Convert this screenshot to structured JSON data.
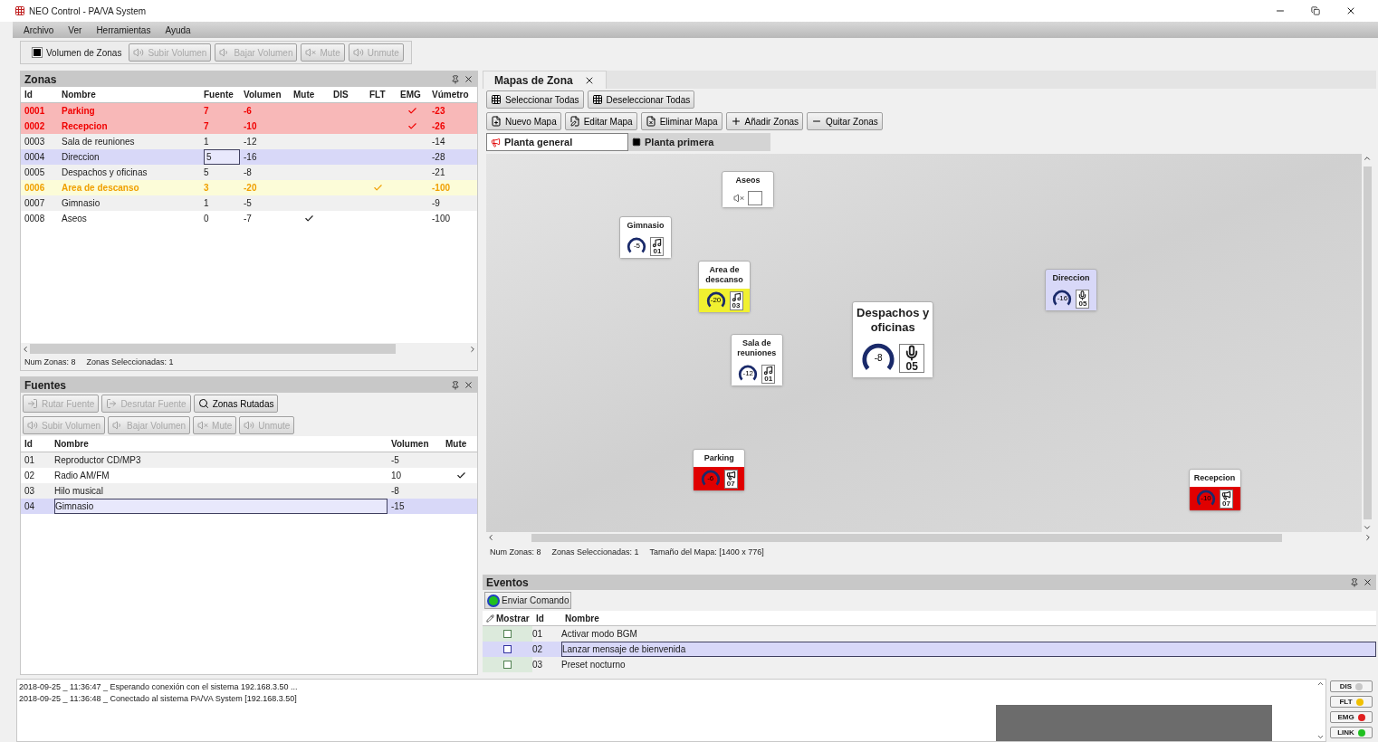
{
  "window": {
    "title": "NEO Control - PA/VA System"
  },
  "menu": [
    "Archivo",
    "Ver",
    "Herramientas",
    "Ayuda"
  ],
  "toolbar": {
    "toggle": {
      "label": "Volumen de Zonas",
      "checked": true
    },
    "buttons": [
      {
        "label": "Subir Volumen",
        "disabled": true
      },
      {
        "label": "Bajar Volumen",
        "disabled": true
      },
      {
        "label": "Mute",
        "disabled": true
      },
      {
        "label": "Unmute",
        "disabled": true
      }
    ]
  },
  "zones_panel": {
    "title": "Zonas",
    "columns": [
      "Id",
      "Nombre",
      "Fuente",
      "Volumen",
      "Mute",
      "DIS",
      "FLT",
      "EMG",
      "Vúmetro"
    ],
    "rows": [
      {
        "id": "0001",
        "name": "Parking",
        "source": "7",
        "volume": "-6",
        "mute": false,
        "dis": false,
        "flt": false,
        "emg": true,
        "vu": "-23",
        "selected": false
      },
      {
        "id": "0002",
        "name": "Recepcion",
        "source": "7",
        "volume": "-10",
        "mute": false,
        "dis": false,
        "flt": false,
        "emg": true,
        "vu": "-26",
        "selected": false
      },
      {
        "id": "0003",
        "name": "Sala de reuniones",
        "source": "1",
        "volume": "-12",
        "mute": false,
        "dis": false,
        "flt": false,
        "emg": false,
        "vu": "-14",
        "selected": false
      },
      {
        "id": "0004",
        "name": "Direccion",
        "source": "5",
        "volume": "-16",
        "mute": false,
        "dis": false,
        "flt": false,
        "emg": false,
        "vu": "-28",
        "selected": true
      },
      {
        "id": "0005",
        "name": "Despachos y oficinas",
        "source": "5",
        "volume": "-8",
        "mute": false,
        "dis": false,
        "flt": false,
        "emg": false,
        "vu": "-21",
        "selected": false
      },
      {
        "id": "0006",
        "name": "Area de descanso",
        "source": "3",
        "volume": "-20",
        "mute": false,
        "dis": false,
        "flt": true,
        "emg": false,
        "vu": "-100",
        "selected": false
      },
      {
        "id": "0007",
        "name": "Gimnasio",
        "source": "1",
        "volume": "-5",
        "mute": false,
        "dis": false,
        "flt": false,
        "emg": false,
        "vu": "-9",
        "selected": false
      },
      {
        "id": "0008",
        "name": "Aseos",
        "source": "0",
        "volume": "-7",
        "mute": true,
        "dis": false,
        "flt": false,
        "emg": false,
        "vu": "-100",
        "selected": false
      }
    ],
    "status": [
      "Num Zonas: 8",
      "Zonas Seleccionadas: 1"
    ]
  },
  "sources_panel": {
    "title": "Fuentes",
    "buttons_row_1": [
      {
        "label": "Rutar Fuente",
        "disabled": true
      },
      {
        "label": "Desrutar Fuente",
        "disabled": true
      },
      {
        "label": "Zonas Rutadas",
        "disabled": false
      }
    ],
    "buttons_row_2": [
      {
        "label": "Subir Volumen",
        "disabled": true
      },
      {
        "label": "Bajar Volumen",
        "disabled": true
      },
      {
        "label": "Mute",
        "disabled": true
      },
      {
        "label": "Unmute",
        "disabled": true
      }
    ],
    "columns": [
      "Id",
      "Nombre",
      "Volumen",
      "Mute"
    ],
    "rows": [
      {
        "id": "01",
        "name": "Reproductor CD/MP3",
        "volume": "-5",
        "mute": false,
        "selected": false
      },
      {
        "id": "02",
        "name": "Radio AM/FM",
        "volume": "10",
        "mute": true,
        "selected": false
      },
      {
        "id": "03",
        "name": "Hilo musical",
        "volume": "-8",
        "mute": false,
        "selected": false
      },
      {
        "id": "04",
        "name": "Gimnasio",
        "volume": "-15",
        "mute": false,
        "selected": true
      }
    ]
  },
  "map_panel": {
    "tab": "Mapas de Zona",
    "select_buttons": [
      "Seleccionar Todas",
      "Deseleccionar Todas"
    ],
    "map_buttons": [
      "Nuevo Mapa",
      "Editar Mapa",
      "Eliminar Mapa",
      "Añadir Zonas",
      "Quitar Zonas"
    ],
    "floors": [
      {
        "label": "Planta general",
        "selected": true
      },
      {
        "label": "Planta primera",
        "selected": false
      }
    ],
    "markers": [
      {
        "name": "Aseos",
        "muted": true,
        "selected": false,
        "emg": false,
        "flt": false,
        "large": false
      },
      {
        "name": "Gimnasio",
        "muted": false,
        "selected": false,
        "emg": false,
        "flt": false,
        "large": false,
        "volume": "-5",
        "source": {
          "kind": "music",
          "number": "01"
        }
      },
      {
        "name": "Area de descanso",
        "muted": false,
        "selected": false,
        "emg": false,
        "flt": true,
        "large": false,
        "volume": "-20",
        "source": {
          "kind": "music",
          "number": "03"
        }
      },
      {
        "name": "Direccion",
        "muted": false,
        "selected": true,
        "emg": false,
        "flt": false,
        "large": false,
        "volume": "-16",
        "source": {
          "kind": "mic",
          "number": "05"
        }
      },
      {
        "name": "Sala de reuniones",
        "muted": false,
        "selected": false,
        "emg": false,
        "flt": false,
        "large": false,
        "volume": "-12",
        "source": {
          "kind": "music",
          "number": "01"
        }
      },
      {
        "name": "Despachos y oficinas",
        "muted": false,
        "selected": false,
        "emg": false,
        "flt": false,
        "large": true,
        "volume": "-8",
        "source": {
          "kind": "mic",
          "number": "05"
        }
      },
      {
        "name": "Parking",
        "muted": false,
        "selected": false,
        "emg": true,
        "flt": false,
        "large": false,
        "volume": "-6",
        "source": {
          "kind": "megaphone",
          "number": "07"
        }
      },
      {
        "name": "Recepcion",
        "muted": false,
        "selected": false,
        "emg": true,
        "flt": false,
        "large": false,
        "volume": "-10",
        "source": {
          "kind": "megaphone",
          "number": "07"
        }
      }
    ],
    "status": [
      "Num Zonas: 8",
      "Zonas Seleccionadas: 1",
      "Tamaño del Mapa: [1400 x 776]"
    ]
  },
  "events_panel": {
    "title": "Eventos",
    "button": "Enviar Comando",
    "columns": [
      "Mostrar",
      "Id",
      "Nombre"
    ],
    "rows": [
      {
        "checked": false,
        "id": "01",
        "name": "Activar modo BGM",
        "selected": false
      },
      {
        "checked": false,
        "id": "02",
        "name": "Lanzar mensaje de bienvenida",
        "selected": true
      },
      {
        "checked": false,
        "id": "03",
        "name": "Preset nocturno",
        "selected": false
      }
    ]
  },
  "log": [
    "2018-09-25 _ 11:36:47 _ Esperando conexión con el sistema 192.168.3.50 ...",
    "2018-09-25 _ 11:36:48 _ Conectado al sistema PA/VA System [192.168.3.50]"
  ],
  "indicators": [
    {
      "label": "DIS",
      "color": "#c8c8c8"
    },
    {
      "label": "FLT",
      "color": "#f0c000"
    },
    {
      "label": "EMG",
      "color": "#e02020"
    },
    {
      "label": "LINK",
      "color": "#20c020"
    }
  ]
}
